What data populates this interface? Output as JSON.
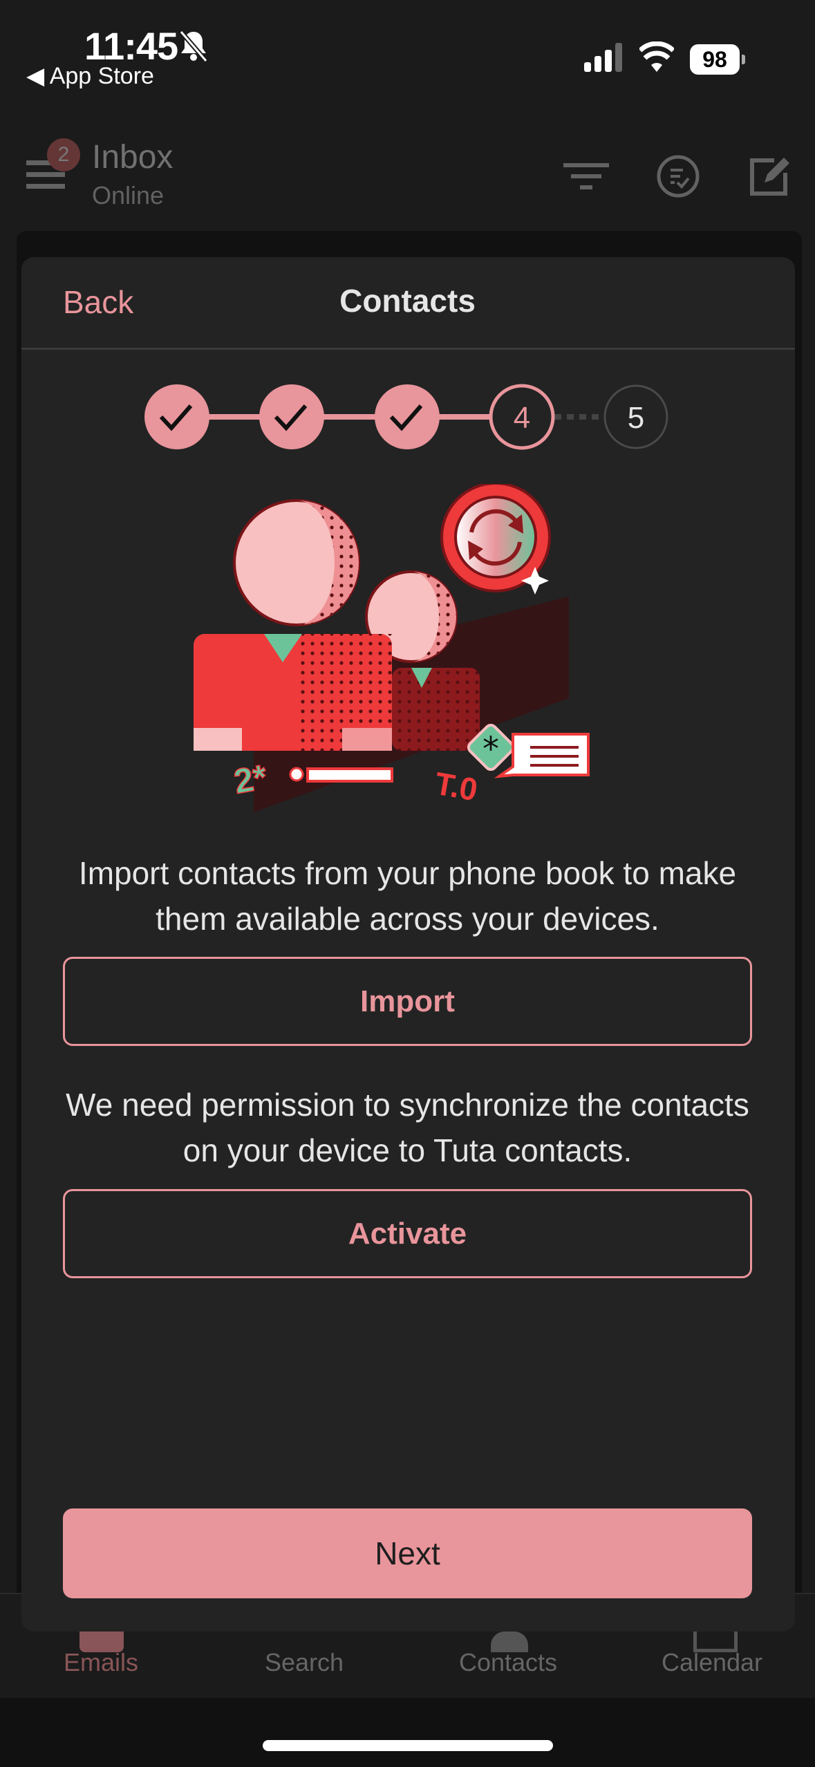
{
  "status_bar": {
    "time": "11:45",
    "back_app": "App Store",
    "battery": "98",
    "icons": [
      "bell-slash-icon",
      "signal-icon",
      "wifi-icon",
      "battery-icon"
    ]
  },
  "header": {
    "title": "Inbox",
    "subtitle": "Online",
    "unread_badge": "2",
    "icons": [
      "menu-icon",
      "filter-icon",
      "select-icon",
      "compose-icon"
    ]
  },
  "modal": {
    "back_label": "Back",
    "title": "Contacts",
    "stepper": {
      "steps": [
        "1",
        "2",
        "3",
        "4",
        "5"
      ],
      "completed": 3,
      "current": "4"
    },
    "import_text": "Import contacts from your phone book to make them available across your devices.",
    "import_label": "Import",
    "sync_text": "We need permission to synchronize the contacts on your device to Tuta contacts.",
    "activate_label": "Activate",
    "next_label": "Next",
    "illustration_marks": {
      "left": "2*",
      "right": "T.0"
    }
  },
  "tabbar": {
    "items": [
      {
        "label": "Emails",
        "active": true
      },
      {
        "label": "Search"
      },
      {
        "label": "Contacts"
      },
      {
        "label": "Calendar"
      }
    ]
  },
  "colors": {
    "accent": "#e8959b",
    "modal_bg": "#232323",
    "background": "#1b1b1b"
  }
}
